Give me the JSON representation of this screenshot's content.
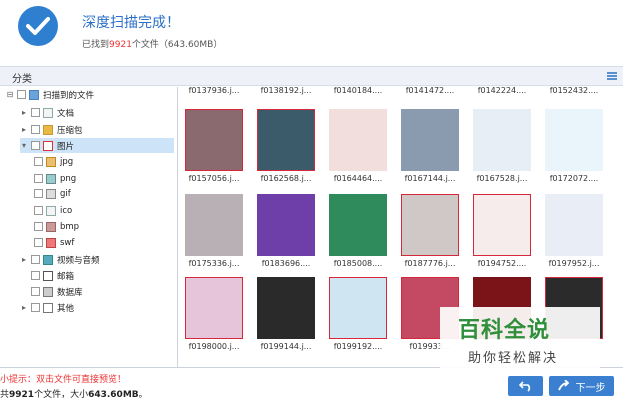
{
  "header": {
    "title": "深度扫描完成！",
    "subtitle_prefix": "已找到",
    "file_count": "9921",
    "subtitle_suffix": "个文件（643.60MB）"
  },
  "tabbar": {
    "label": "分类"
  },
  "tree": [
    {
      "label": "扫描到的文件",
      "icon": "folder",
      "level": 0,
      "expander": "⊟"
    },
    {
      "label": "文档",
      "icon": "doc",
      "level": 1,
      "expander": "▸"
    },
    {
      "label": "压缩包",
      "icon": "zip",
      "level": 1,
      "expander": "▸"
    },
    {
      "label": "图片",
      "icon": "img",
      "level": 1,
      "expander": "▾",
      "selected": true
    },
    {
      "label": "jpg",
      "icon": "jpg",
      "level": 2,
      "expander": ""
    },
    {
      "label": "png",
      "icon": "png",
      "level": 2,
      "expander": ""
    },
    {
      "label": "gif",
      "icon": "gif",
      "level": 2,
      "expander": ""
    },
    {
      "label": "ico",
      "icon": "ico",
      "level": 2,
      "expander": ""
    },
    {
      "label": "bmp",
      "icon": "bmp",
      "level": 2,
      "expander": ""
    },
    {
      "label": "swf",
      "icon": "swf",
      "level": 2,
      "expander": ""
    },
    {
      "label": "视频与音频",
      "icon": "music",
      "level": 1,
      "expander": "▸"
    },
    {
      "label": "邮箱",
      "icon": "mail",
      "level": 1,
      "expander": ""
    },
    {
      "label": "数据库",
      "icon": "db",
      "level": 1,
      "expander": ""
    },
    {
      "label": "其他",
      "icon": "other",
      "level": 1,
      "expander": "▸"
    }
  ],
  "grid": {
    "rows": [
      [
        {
          "name": "f0137936.j...",
          "color": "#d9c5cf"
        },
        {
          "name": "f0138192.j...",
          "color": "#c9d4dd"
        },
        {
          "name": "f0140184....",
          "color": "#e4e4e4"
        },
        {
          "name": "f0141472....",
          "color": "#ddd"
        },
        {
          "name": "f0142224....",
          "color": "#eee"
        },
        {
          "name": "f0152432....",
          "color": "#eee"
        }
      ],
      [
        {
          "name": "f0157056.j...",
          "color": "#8a6a6e",
          "selected": true
        },
        {
          "name": "f0162568.j...",
          "color": "#3b5b6a",
          "selected": true
        },
        {
          "name": "f0164464....",
          "color": "#f3dede"
        },
        {
          "name": "f0167144.j...",
          "color": "#8a9bb0"
        },
        {
          "name": "f0167528.j...",
          "color": "#e8eef6"
        },
        {
          "name": "f0172072....",
          "color": "#eaf4fb"
        }
      ],
      [
        {
          "name": "f0175336.j...",
          "color": "#b8b0b4"
        },
        {
          "name": "f0183696....",
          "color": "#6e3fa8"
        },
        {
          "name": "f0185008....",
          "color": "#2f8a5c"
        },
        {
          "name": "f0187776.j...",
          "color": "#cfc8c7",
          "selected": true
        },
        {
          "name": "f0194752....",
          "color": "#f7ecec",
          "selected": true
        },
        {
          "name": "f0197952.j...",
          "color": "#e9edf6"
        }
      ],
      [
        {
          "name": "f0198000.j...",
          "color": "#e6c4da",
          "selected": true
        },
        {
          "name": "f0199144.j...",
          "color": "#2a2a2a"
        },
        {
          "name": "f0199192....",
          "color": "#cfe6f2",
          "selected": true
        },
        {
          "name": "f019933...",
          "color": "#c34a62",
          "selected": true
        },
        {
          "name": "",
          "color": "#7a1418"
        },
        {
          "name": "",
          "color": "#2b2b2b",
          "selected": true
        }
      ]
    ]
  },
  "footer": {
    "tip": "小提示：双击文件可直接预览！",
    "summary_prefix": "共",
    "count": "9921",
    "summary_mid": "个文件，大小",
    "size": "643.60MB",
    "summary_suffix": "。",
    "back_icon": "undo-icon",
    "next_label": "下一步"
  },
  "watermark": {
    "title": "百科全说",
    "subtitle": "助你轻松解决"
  },
  "colors": {
    "accent": "#3b80d0",
    "highlight": "#e33",
    "selection": "#d6283a",
    "watermark": "#2f8f3a"
  }
}
